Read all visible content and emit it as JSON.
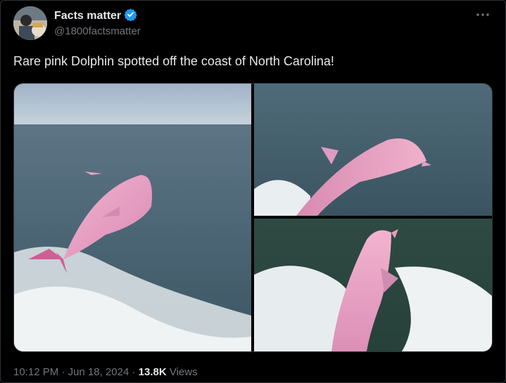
{
  "author": {
    "name": "Facts matter",
    "handle": "@1800factsmatter",
    "avatar_icon": "avatar-photo",
    "verified_icon": "verified-badge-icon"
  },
  "post": {
    "text": "Rare pink Dolphin spotted off the coast of North Carolina!",
    "time": "10:12 PM",
    "separator": "·",
    "date": "Jun 18, 2024",
    "views_count": "13.8K",
    "views_label": "Views"
  },
  "media": {
    "images": [
      {
        "description": "pink dolphin leaping from wake"
      },
      {
        "description": "pink dolphin jumping beside boat"
      },
      {
        "description": "pink dolphin surfacing in wake"
      }
    ]
  },
  "colors": {
    "background": "#000000",
    "text_primary": "#e7e9ea",
    "text_secondary": "#71767b",
    "verified_blue": "#1d9bf0",
    "border": "#2f3336"
  },
  "more_icon": "more-horizontal-icon"
}
